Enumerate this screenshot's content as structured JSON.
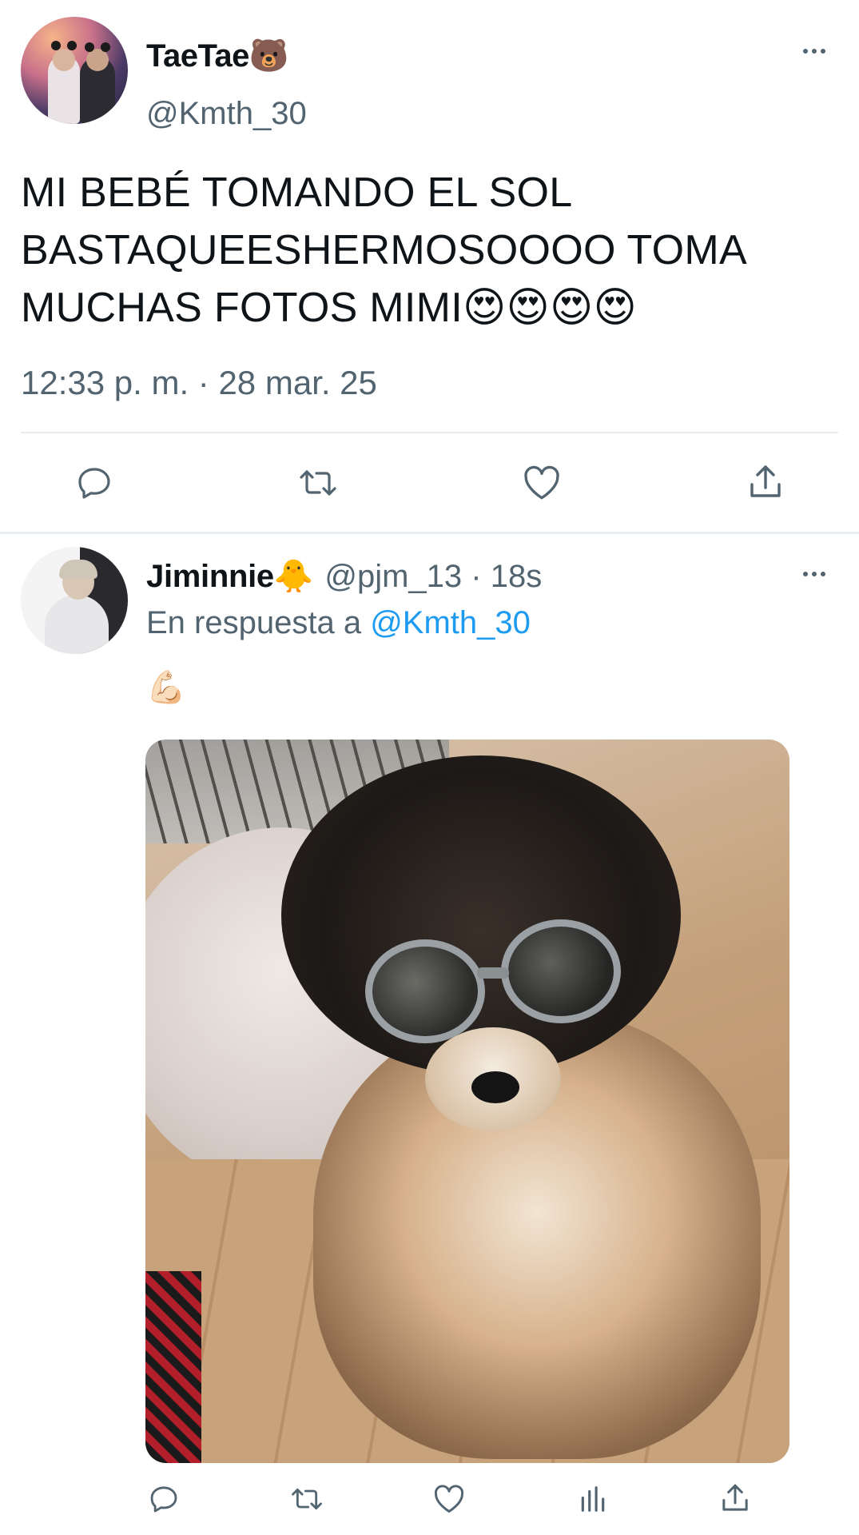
{
  "colors": {
    "accent": "#1d9bf0",
    "secondary_text": "#536471",
    "primary_text": "#0f1419",
    "divider": "#e6ecf0"
  },
  "main_tweet": {
    "author_name": "TaeTae🐻",
    "author_handle": "@Kmth_30",
    "text": "MI BEBÉ TOMANDO EL SOL BASTAQUEESHERMOSOOOO TOMA MUCHAS FOTOS MIMI😍😍😍😍",
    "timestamp": "12:33 p. m. · 28 mar. 25",
    "actions": [
      "reply-icon",
      "retweet-icon",
      "like-icon",
      "share-icon"
    ]
  },
  "reply_tweet": {
    "author_name": "Jiminnie🐥",
    "author_meta": "@pjm_13 · 18s",
    "reply_prefix": "En respuesta a ",
    "reply_to": "@Kmth_30",
    "text": "💪🏻",
    "actions": [
      "reply-icon",
      "retweet-icon",
      "like-icon",
      "analytics-icon",
      "share-icon"
    ]
  }
}
